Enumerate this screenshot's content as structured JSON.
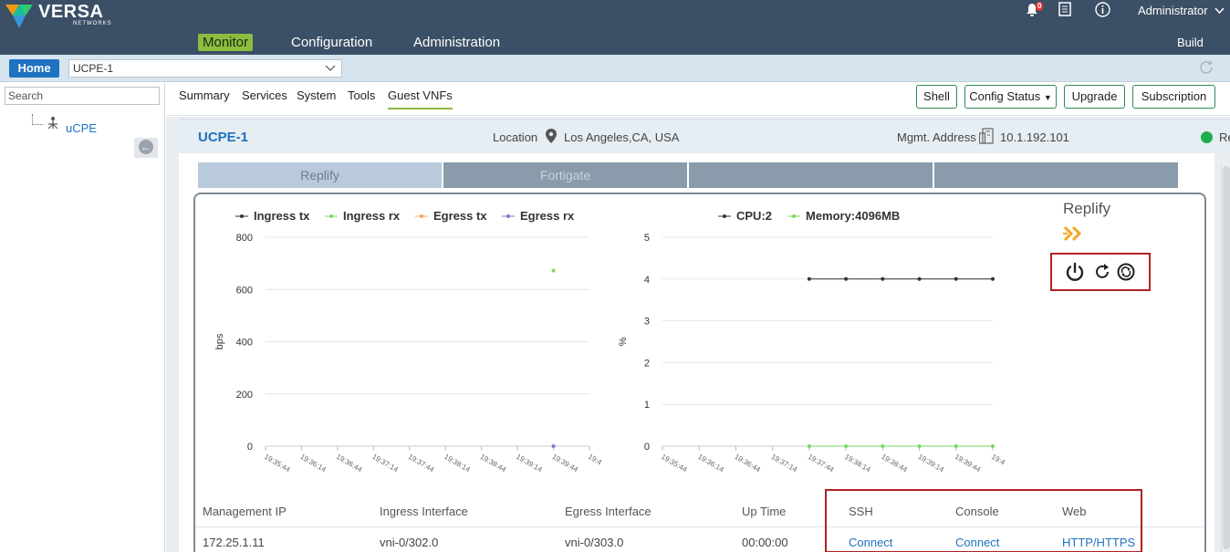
{
  "brand": {
    "name": "VERSA",
    "sub": "NETWORKS"
  },
  "nav": [
    "Monitor",
    "Configuration",
    "Administration"
  ],
  "topbar": {
    "notification_count": "0",
    "user": "Administrator",
    "build_label": "Build"
  },
  "subbar": {
    "home_label": "Home",
    "selected_device": "UCPE-1"
  },
  "left_panel": {
    "search_placeholder": "Search",
    "tree_node": "uCPE"
  },
  "tabs": [
    "Summary",
    "Services",
    "System",
    "Tools",
    "Guest VNFs"
  ],
  "actions": [
    "Shell",
    "Config Status",
    "Upgrade",
    "Subscription"
  ],
  "device": {
    "name": "UCPE-1",
    "location_label": "Location",
    "location": "Los Angeles,CA, USA",
    "mgmt_label": "Mgmt. Address",
    "mgmt_address": "10.1.192.101",
    "status_text": "Re"
  },
  "vnf_tabs": [
    "Replify",
    "Fortigate",
    "",
    ""
  ],
  "vnf_panel": {
    "name": "Replify"
  },
  "chart_data": [
    {
      "type": "line",
      "series": [
        {
          "name": "Ingress tx",
          "color": "#333333",
          "values": [
            null,
            null,
            null,
            null,
            null,
            null,
            null,
            null,
            null
          ]
        },
        {
          "name": "Ingress rx",
          "color": "#7cd85c",
          "values": [
            null,
            null,
            null,
            null,
            null,
            null,
            null,
            null,
            672
          ]
        },
        {
          "name": "Egress tx",
          "color": "#f4a460",
          "values": [
            null,
            null,
            null,
            null,
            null,
            null,
            null,
            null,
            null
          ]
        },
        {
          "name": "Egress rx",
          "color": "#7b7bd6",
          "values": [
            null,
            null,
            null,
            null,
            null,
            null,
            null,
            null,
            0
          ]
        }
      ],
      "categories": [
        "19:35:44",
        "19:36:14",
        "19:36:44",
        "19:37:14",
        "19:37:44",
        "19:38:14",
        "19:38:44",
        "19:39:14",
        "19:39:44",
        "19:4"
      ],
      "ylabel": "bps",
      "yticks": [
        0,
        200,
        400,
        600,
        800
      ],
      "ylim": [
        0,
        800
      ],
      "grid": true,
      "legend": "top"
    },
    {
      "type": "line",
      "series": [
        {
          "name": "CPU:2",
          "color": "#333333",
          "values": [
            null,
            null,
            null,
            null,
            4,
            4,
            4,
            4,
            4,
            4
          ]
        },
        {
          "name": "Memory:4096MB",
          "color": "#7cd85c",
          "values": [
            null,
            null,
            null,
            null,
            0,
            0,
            0,
            0,
            0,
            0
          ]
        }
      ],
      "categories": [
        "19:35:44",
        "19:36:14",
        "19:36:44",
        "19:37:14",
        "19:37:44",
        "19:38:14",
        "19:38:44",
        "19:39:14",
        "19:39:44",
        "19:4"
      ],
      "ylabel": "%",
      "yticks": [
        0,
        1,
        2,
        3,
        4,
        5
      ],
      "ylim": [
        0,
        5
      ],
      "grid": true,
      "legend": "top"
    }
  ],
  "table": {
    "headers": [
      "Management IP",
      "Ingress Interface",
      "Egress Interface",
      "Up Time",
      "SSH",
      "Console",
      "Web"
    ],
    "row": {
      "management_ip": "172.25.1.11",
      "ingress": "vni-0/302.0",
      "egress": "vni-0/303.0",
      "uptime": "00:00:00",
      "ssh": "Connect",
      "console": "Connect",
      "web": "HTTP/HTTPS"
    }
  }
}
